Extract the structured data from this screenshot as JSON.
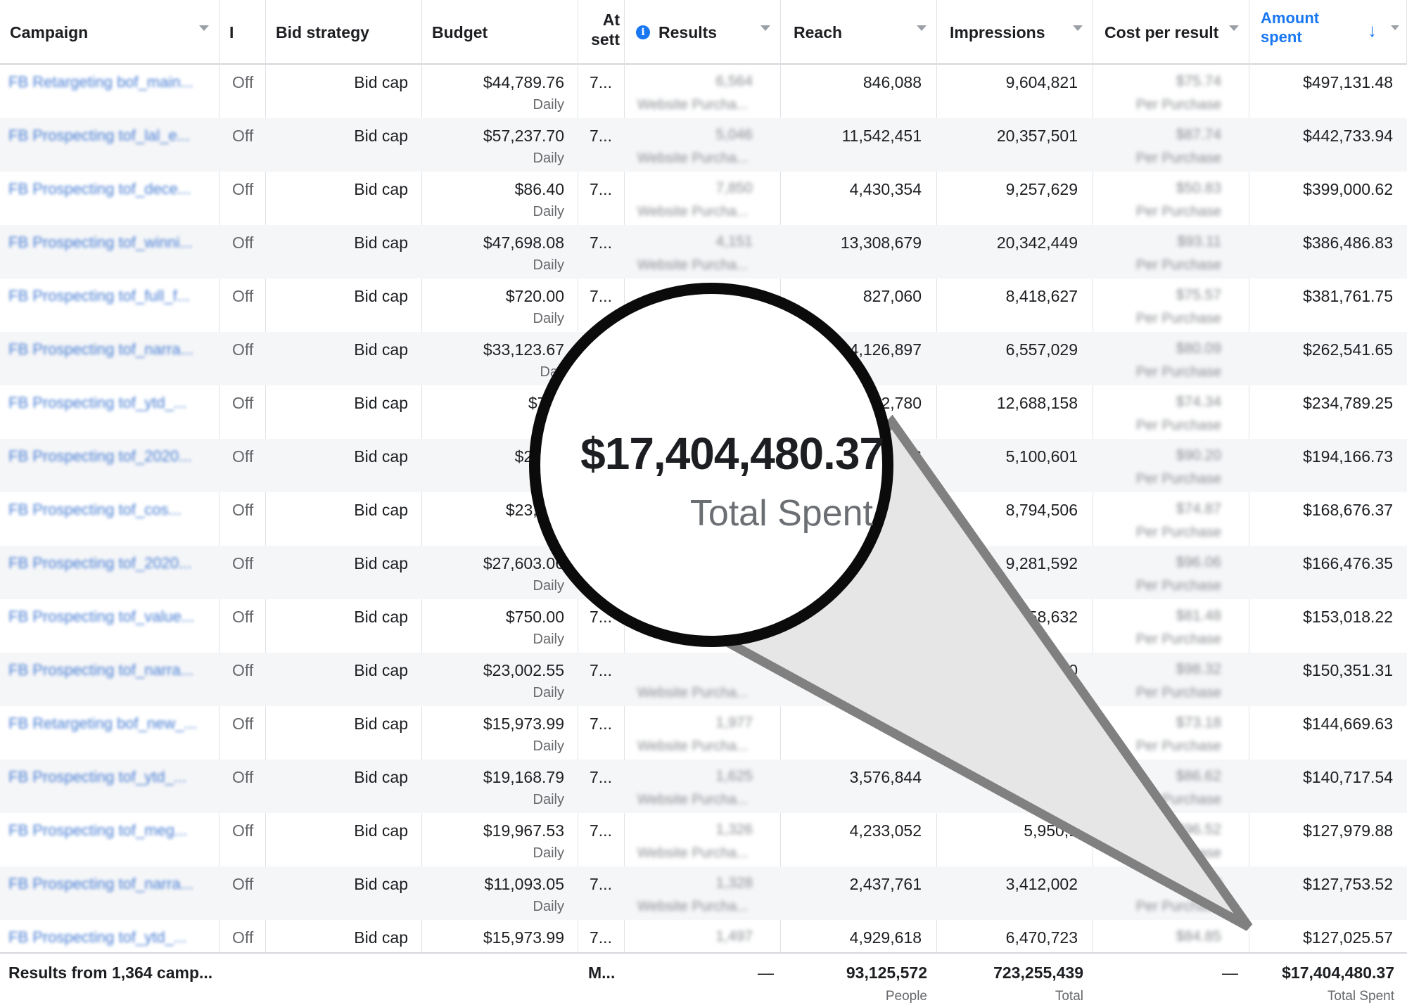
{
  "header": {
    "campaign": "Campaign",
    "delivery": "I",
    "bid_strategy": "Bid strategy",
    "budget": "Budget",
    "attribution_line1": "At",
    "attribution_line2": "sett",
    "results": "Results",
    "reach": "Reach",
    "impressions": "Impressions",
    "cost_per_result": "Cost per result",
    "amount_spent_line1": "Amount",
    "amount_spent_line2": "spent",
    "sort_arrow": "↓"
  },
  "rows": [
    {
      "campaign": "FB Retargeting bof_main...",
      "delivery": "Off",
      "bid": "Bid cap",
      "budget": "$44,789.76",
      "budget_sub": "Daily",
      "attr": "7...",
      "results": "6,564",
      "results_sub": "Website Purcha...",
      "reach": "846,088",
      "impressions": "9,604,821",
      "cpr": "$75.74",
      "cpr_sub": "Per Purchase",
      "spent": "$497,131.48"
    },
    {
      "campaign": "FB Prospecting tof_lal_e...",
      "delivery": "Off",
      "bid": "Bid cap",
      "budget": "$57,237.70",
      "budget_sub": "Daily",
      "attr": "7...",
      "results": "5,046",
      "results_sub": "Website Purcha...",
      "reach": "11,542,451",
      "impressions": "20,357,501",
      "cpr": "$87.74",
      "cpr_sub": "Per Purchase",
      "spent": "$442,733.94"
    },
    {
      "campaign": "FB Prospecting tof_dece...",
      "delivery": "Off",
      "bid": "Bid cap",
      "budget": "$86.40",
      "budget_sub": "Daily",
      "attr": "7...",
      "results": "7,850",
      "results_sub": "Website Purcha...",
      "reach": "4,430,354",
      "impressions": "9,257,629",
      "cpr": "$50.83",
      "cpr_sub": "Per Purchase",
      "spent": "$399,000.62"
    },
    {
      "campaign": "FB Prospecting tof_winni...",
      "delivery": "Off",
      "bid": "Bid cap",
      "budget": "$47,698.08",
      "budget_sub": "Daily",
      "attr": "7...",
      "results": "4,151",
      "results_sub": "Website Purcha...",
      "reach": "13,308,679",
      "impressions": "20,342,449",
      "cpr": "$93.11",
      "cpr_sub": "Per Purchase",
      "spent": "$386,486.83"
    },
    {
      "campaign": "FB Prospecting tof_full_f...",
      "delivery": "Off",
      "bid": "Bid cap",
      "budget": "$720.00",
      "budget_sub": "Daily",
      "attr": "7...",
      "results": "",
      "results_sub": "",
      "reach": "827,060",
      "impressions": "8,418,627",
      "cpr": "$75.57",
      "cpr_sub": "Per Purchase",
      "spent": "$381,761.75"
    },
    {
      "campaign": "FB Prospecting tof_narra...",
      "delivery": "Off",
      "bid": "Bid cap",
      "budget": "$33,123.67",
      "budget_sub": "Dail",
      "attr": "",
      "results": "",
      "results_sub": "",
      "reach": "4,126,897",
      "impressions": "6,557,029",
      "cpr": "$80.09",
      "cpr_sub": "Per Purchase",
      "spent": "$262,541.65"
    },
    {
      "campaign": "FB Prospecting tof_ytd_...",
      "delivery": "Off",
      "bid": "Bid cap",
      "budget": "$720",
      "budget_sub": "",
      "attr": "",
      "results": "",
      "results_sub": "",
      "reach": "2,780",
      "impressions": "12,688,158",
      "cpr": "$74.34",
      "cpr_sub": "Per Purchase",
      "spent": "$234,789.25"
    },
    {
      "campaign": "FB Prospecting tof_2020...",
      "delivery": "Off",
      "bid": "Bid cap",
      "budget": "$27,60",
      "budget_sub": "",
      "attr": "",
      "results": "",
      "results_sub": "",
      "reach": "36",
      "impressions": "5,100,601",
      "cpr": "$90.20",
      "cpr_sub": "Per Purchase",
      "spent": "$194,166.73"
    },
    {
      "campaign": "FB Prospecting tof_cos...",
      "delivery": "Off",
      "bid": "Bid cap",
      "budget": "$23,002",
      "budget_sub": "Da",
      "attr": "",
      "results": "",
      "results_sub": "",
      "reach": "",
      "impressions": "8,794,506",
      "cpr": "$74.87",
      "cpr_sub": "Per Purchase",
      "spent": "$168,676.37"
    },
    {
      "campaign": "FB Prospecting tof_2020...",
      "delivery": "Off",
      "bid": "Bid cap",
      "budget": "$27,603.06",
      "budget_sub": "Daily",
      "attr": "",
      "results": "",
      "results_sub": "",
      "reach": "",
      "impressions": "9,281,592",
      "cpr": "$96.06",
      "cpr_sub": "Per Purchase",
      "spent": "$166,476.35"
    },
    {
      "campaign": "FB Prospecting tof_value...",
      "delivery": "Off",
      "bid": "Bid cap",
      "budget": "$750.00",
      "budget_sub": "Daily",
      "attr": "7...",
      "results": "",
      "results_sub": "",
      "reach": "",
      "impressions": "058,632",
      "cpr": "$81.48",
      "cpr_sub": "Per Purchase",
      "spent": "$153,018.22"
    },
    {
      "campaign": "FB Prospecting tof_narra...",
      "delivery": "Off",
      "bid": "Bid cap",
      "budget": "$23,002.55",
      "budget_sub": "Daily",
      "attr": "7...",
      "results": "",
      "results_sub": "Website Purcha...",
      "reach": "",
      "impressions": "10",
      "cpr": "$98.32",
      "cpr_sub": "Per Purchase",
      "spent": "$150,351.31"
    },
    {
      "campaign": "FB Retargeting bof_new_...",
      "delivery": "Off",
      "bid": "Bid cap",
      "budget": "$15,973.99",
      "budget_sub": "Daily",
      "attr": "7...",
      "results": "1,977",
      "results_sub": "Website Purcha...",
      "reach": "",
      "impressions": "",
      "cpr": "$73.18",
      "cpr_sub": "Per Purchase",
      "spent": "$144,669.63"
    },
    {
      "campaign": "FB Prospecting tof_ytd_...",
      "delivery": "Off",
      "bid": "Bid cap",
      "budget": "$19,168.79",
      "budget_sub": "Daily",
      "attr": "7...",
      "results": "1,625",
      "results_sub": "Website Purcha...",
      "reach": "3,576,844",
      "impressions": "",
      "cpr": "$86.62",
      "cpr_sub": "Per Purchase",
      "spent": "$140,717.54"
    },
    {
      "campaign": "FB Prospecting tof_meg...",
      "delivery": "Off",
      "bid": "Bid cap",
      "budget": "$19,967.53",
      "budget_sub": "Daily",
      "attr": "7...",
      "results": "1,326",
      "results_sub": "Website Purcha...",
      "reach": "4,233,052",
      "impressions": "5,950,1",
      "cpr": "$96.52",
      "cpr_sub": "Per Purchase",
      "spent": "$127,979.88"
    },
    {
      "campaign": "FB Prospecting tof_narra...",
      "delivery": "Off",
      "bid": "Bid cap",
      "budget": "$11,093.05",
      "budget_sub": "Daily",
      "attr": "7...",
      "results": "1,328",
      "results_sub": "Website Purcha...",
      "reach": "2,437,761",
      "impressions": "3,412,002",
      "cpr": "$96.20",
      "cpr_sub": "Per Purchase",
      "spent": "$127,753.52"
    },
    {
      "campaign": "FB Prospecting tof_ytd_...",
      "delivery": "Off",
      "bid": "Bid cap",
      "budget": "$15,973.99",
      "budget_sub": "",
      "attr": "7...",
      "results": "1,497",
      "results_sub": "",
      "reach": "4,929,618",
      "impressions": "6,470,723",
      "cpr": "$84.85",
      "cpr_sub": "",
      "spent": "$127,025.57"
    }
  ],
  "footer": {
    "results_from": "Results from 1,364 camp...",
    "attr": "M...",
    "results": "—",
    "reach": "93,125,572",
    "reach_sub": "People",
    "impressions": "723,255,439",
    "impressions_sub": "Total",
    "cpr": "—",
    "spent": "$17,404,480.37",
    "spent_sub": "Total Spent"
  },
  "magnifier": {
    "amount": "$17,404,480.37",
    "label": "Total Spent"
  },
  "colors": {
    "link_blue": "#4a7fd4",
    "accent_blue": "#1877f2",
    "row_alt": "#f5f6f8",
    "callout_fill": "#e6e6e6",
    "callout_stroke": "#808080"
  }
}
